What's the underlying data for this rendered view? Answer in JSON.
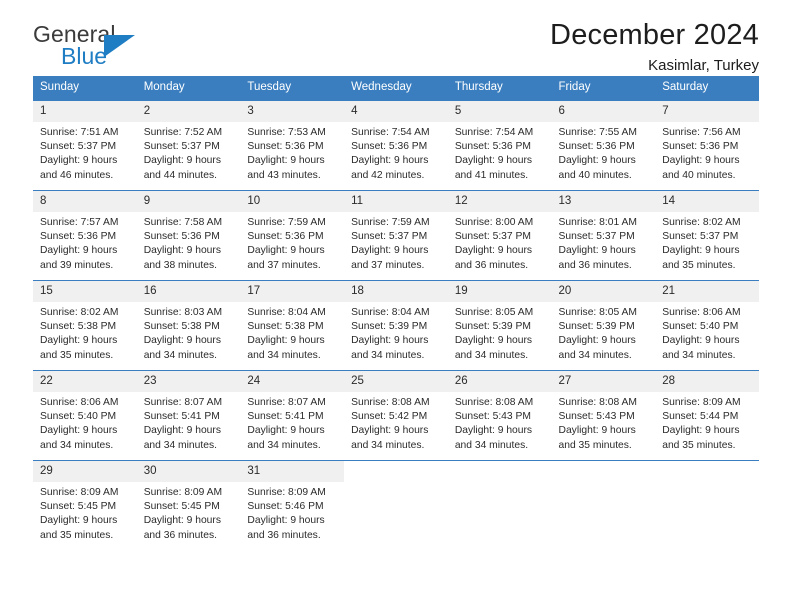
{
  "brand": {
    "name_top": "General",
    "name_bottom": "Blue",
    "colors": {
      "general": "#3b3b3b",
      "blue": "#1f7dc4",
      "header": "#3a7ebf",
      "daynum_bg": "#f0f0f0"
    }
  },
  "header": {
    "title": "December 2024",
    "subtitle": "Kasimlar, Turkey"
  },
  "weekday_headers": [
    "Sunday",
    "Monday",
    "Tuesday",
    "Wednesday",
    "Thursday",
    "Friday",
    "Saturday"
  ],
  "weeks": [
    [
      {
        "day": "1",
        "sunrise": "Sunrise: 7:51 AM",
        "sunset": "Sunset: 5:37 PM",
        "daylight_line1": "Daylight: 9 hours",
        "daylight_line2": "and 46 minutes."
      },
      {
        "day": "2",
        "sunrise": "Sunrise: 7:52 AM",
        "sunset": "Sunset: 5:37 PM",
        "daylight_line1": "Daylight: 9 hours",
        "daylight_line2": "and 44 minutes."
      },
      {
        "day": "3",
        "sunrise": "Sunrise: 7:53 AM",
        "sunset": "Sunset: 5:36 PM",
        "daylight_line1": "Daylight: 9 hours",
        "daylight_line2": "and 43 minutes."
      },
      {
        "day": "4",
        "sunrise": "Sunrise: 7:54 AM",
        "sunset": "Sunset: 5:36 PM",
        "daylight_line1": "Daylight: 9 hours",
        "daylight_line2": "and 42 minutes."
      },
      {
        "day": "5",
        "sunrise": "Sunrise: 7:54 AM",
        "sunset": "Sunset: 5:36 PM",
        "daylight_line1": "Daylight: 9 hours",
        "daylight_line2": "and 41 minutes."
      },
      {
        "day": "6",
        "sunrise": "Sunrise: 7:55 AM",
        "sunset": "Sunset: 5:36 PM",
        "daylight_line1": "Daylight: 9 hours",
        "daylight_line2": "and 40 minutes."
      },
      {
        "day": "7",
        "sunrise": "Sunrise: 7:56 AM",
        "sunset": "Sunset: 5:36 PM",
        "daylight_line1": "Daylight: 9 hours",
        "daylight_line2": "and 40 minutes."
      }
    ],
    [
      {
        "day": "8",
        "sunrise": "Sunrise: 7:57 AM",
        "sunset": "Sunset: 5:36 PM",
        "daylight_line1": "Daylight: 9 hours",
        "daylight_line2": "and 39 minutes."
      },
      {
        "day": "9",
        "sunrise": "Sunrise: 7:58 AM",
        "sunset": "Sunset: 5:36 PM",
        "daylight_line1": "Daylight: 9 hours",
        "daylight_line2": "and 38 minutes."
      },
      {
        "day": "10",
        "sunrise": "Sunrise: 7:59 AM",
        "sunset": "Sunset: 5:36 PM",
        "daylight_line1": "Daylight: 9 hours",
        "daylight_line2": "and 37 minutes."
      },
      {
        "day": "11",
        "sunrise": "Sunrise: 7:59 AM",
        "sunset": "Sunset: 5:37 PM",
        "daylight_line1": "Daylight: 9 hours",
        "daylight_line2": "and 37 minutes."
      },
      {
        "day": "12",
        "sunrise": "Sunrise: 8:00 AM",
        "sunset": "Sunset: 5:37 PM",
        "daylight_line1": "Daylight: 9 hours",
        "daylight_line2": "and 36 minutes."
      },
      {
        "day": "13",
        "sunrise": "Sunrise: 8:01 AM",
        "sunset": "Sunset: 5:37 PM",
        "daylight_line1": "Daylight: 9 hours",
        "daylight_line2": "and 36 minutes."
      },
      {
        "day": "14",
        "sunrise": "Sunrise: 8:02 AM",
        "sunset": "Sunset: 5:37 PM",
        "daylight_line1": "Daylight: 9 hours",
        "daylight_line2": "and 35 minutes."
      }
    ],
    [
      {
        "day": "15",
        "sunrise": "Sunrise: 8:02 AM",
        "sunset": "Sunset: 5:38 PM",
        "daylight_line1": "Daylight: 9 hours",
        "daylight_line2": "and 35 minutes."
      },
      {
        "day": "16",
        "sunrise": "Sunrise: 8:03 AM",
        "sunset": "Sunset: 5:38 PM",
        "daylight_line1": "Daylight: 9 hours",
        "daylight_line2": "and 34 minutes."
      },
      {
        "day": "17",
        "sunrise": "Sunrise: 8:04 AM",
        "sunset": "Sunset: 5:38 PM",
        "daylight_line1": "Daylight: 9 hours",
        "daylight_line2": "and 34 minutes."
      },
      {
        "day": "18",
        "sunrise": "Sunrise: 8:04 AM",
        "sunset": "Sunset: 5:39 PM",
        "daylight_line1": "Daylight: 9 hours",
        "daylight_line2": "and 34 minutes."
      },
      {
        "day": "19",
        "sunrise": "Sunrise: 8:05 AM",
        "sunset": "Sunset: 5:39 PM",
        "daylight_line1": "Daylight: 9 hours",
        "daylight_line2": "and 34 minutes."
      },
      {
        "day": "20",
        "sunrise": "Sunrise: 8:05 AM",
        "sunset": "Sunset: 5:39 PM",
        "daylight_line1": "Daylight: 9 hours",
        "daylight_line2": "and 34 minutes."
      },
      {
        "day": "21",
        "sunrise": "Sunrise: 8:06 AM",
        "sunset": "Sunset: 5:40 PM",
        "daylight_line1": "Daylight: 9 hours",
        "daylight_line2": "and 34 minutes."
      }
    ],
    [
      {
        "day": "22",
        "sunrise": "Sunrise: 8:06 AM",
        "sunset": "Sunset: 5:40 PM",
        "daylight_line1": "Daylight: 9 hours",
        "daylight_line2": "and 34 minutes."
      },
      {
        "day": "23",
        "sunrise": "Sunrise: 8:07 AM",
        "sunset": "Sunset: 5:41 PM",
        "daylight_line1": "Daylight: 9 hours",
        "daylight_line2": "and 34 minutes."
      },
      {
        "day": "24",
        "sunrise": "Sunrise: 8:07 AM",
        "sunset": "Sunset: 5:41 PM",
        "daylight_line1": "Daylight: 9 hours",
        "daylight_line2": "and 34 minutes."
      },
      {
        "day": "25",
        "sunrise": "Sunrise: 8:08 AM",
        "sunset": "Sunset: 5:42 PM",
        "daylight_line1": "Daylight: 9 hours",
        "daylight_line2": "and 34 minutes."
      },
      {
        "day": "26",
        "sunrise": "Sunrise: 8:08 AM",
        "sunset": "Sunset: 5:43 PM",
        "daylight_line1": "Daylight: 9 hours",
        "daylight_line2": "and 34 minutes."
      },
      {
        "day": "27",
        "sunrise": "Sunrise: 8:08 AM",
        "sunset": "Sunset: 5:43 PM",
        "daylight_line1": "Daylight: 9 hours",
        "daylight_line2": "and 35 minutes."
      },
      {
        "day": "28",
        "sunrise": "Sunrise: 8:09 AM",
        "sunset": "Sunset: 5:44 PM",
        "daylight_line1": "Daylight: 9 hours",
        "daylight_line2": "and 35 minutes."
      }
    ],
    [
      {
        "day": "29",
        "sunrise": "Sunrise: 8:09 AM",
        "sunset": "Sunset: 5:45 PM",
        "daylight_line1": "Daylight: 9 hours",
        "daylight_line2": "and 35 minutes."
      },
      {
        "day": "30",
        "sunrise": "Sunrise: 8:09 AM",
        "sunset": "Sunset: 5:45 PM",
        "daylight_line1": "Daylight: 9 hours",
        "daylight_line2": "and 36 minutes."
      },
      {
        "day": "31",
        "sunrise": "Sunrise: 8:09 AM",
        "sunset": "Sunset: 5:46 PM",
        "daylight_line1": "Daylight: 9 hours",
        "daylight_line2": "and 36 minutes."
      },
      {
        "day": "",
        "sunrise": "",
        "sunset": "",
        "daylight_line1": "",
        "daylight_line2": ""
      },
      {
        "day": "",
        "sunrise": "",
        "sunset": "",
        "daylight_line1": "",
        "daylight_line2": ""
      },
      {
        "day": "",
        "sunrise": "",
        "sunset": "",
        "daylight_line1": "",
        "daylight_line2": ""
      },
      {
        "day": "",
        "sunrise": "",
        "sunset": "",
        "daylight_line1": "",
        "daylight_line2": ""
      }
    ]
  ]
}
